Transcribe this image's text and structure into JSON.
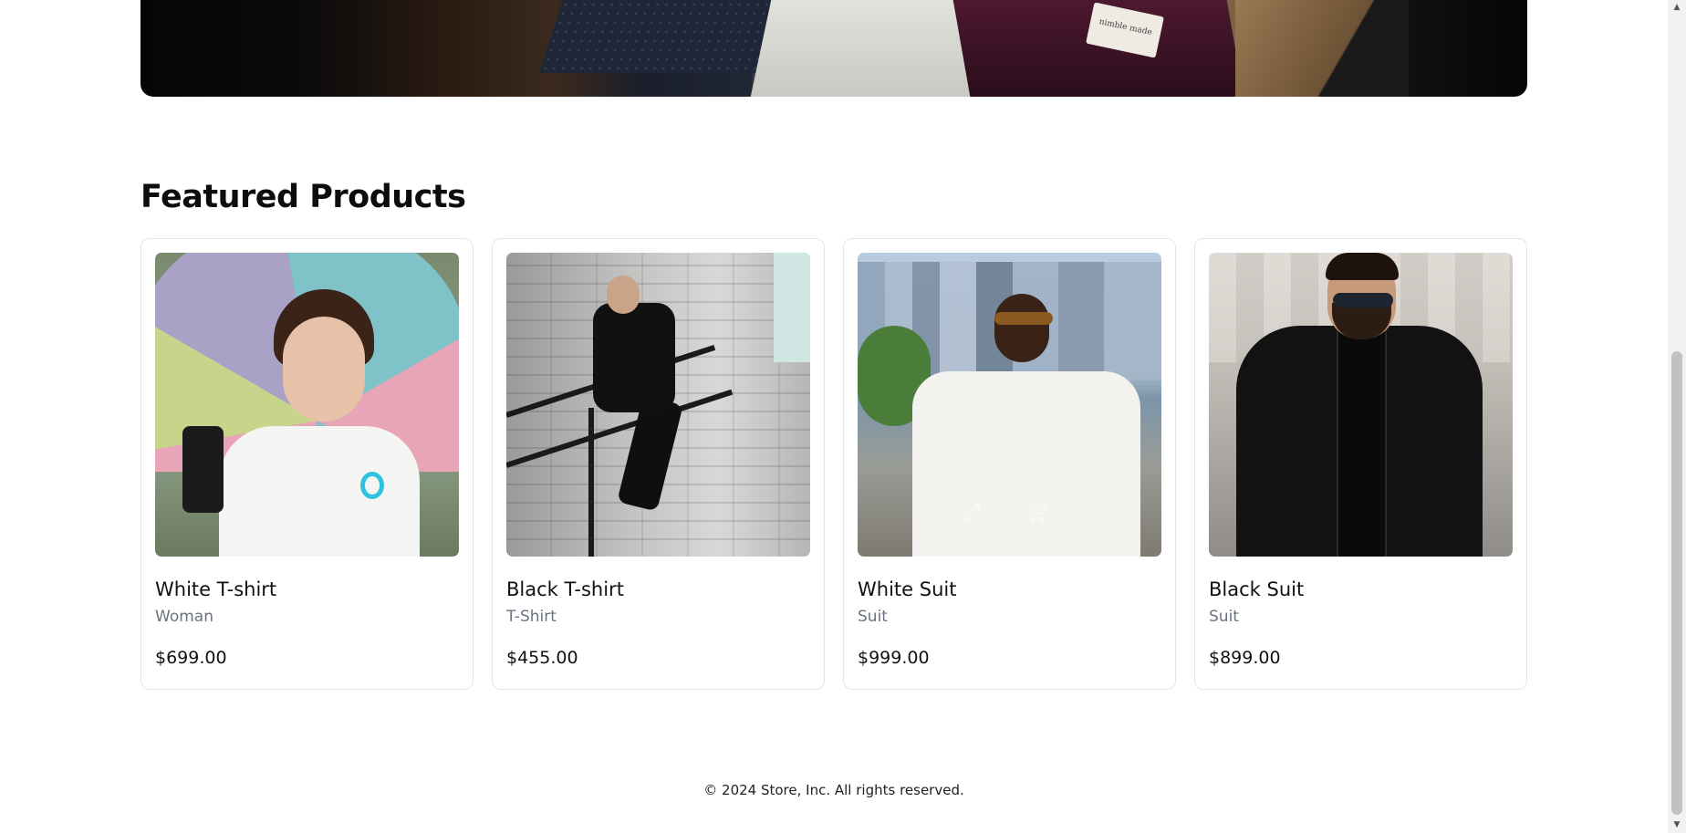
{
  "hero": {
    "label_text": "nimble made"
  },
  "featured": {
    "title": "Featured Products",
    "products": [
      {
        "name": "White T-shirt",
        "category": "Woman",
        "price": "$699.00",
        "image": "woman-umbrella-photo"
      },
      {
        "name": "Black T-shirt",
        "category": "T-Shirt",
        "price": "$455.00",
        "image": "man-jumping-railing-photo"
      },
      {
        "name": "White Suit",
        "category": "Suit",
        "price": "$999.00",
        "image": "man-white-suit-photo",
        "hover_icons": [
          "expand-icon",
          "cart-icon"
        ]
      },
      {
        "name": "Black Suit",
        "category": "Suit",
        "price": "$899.00",
        "image": "man-black-suit-photo"
      }
    ]
  },
  "footer": {
    "copyright": "© 2024 Store, Inc. All rights reserved."
  },
  "colors": {
    "text": "#111111",
    "muted": "#6b7280",
    "border": "#e6e6e6",
    "background": "#ffffff"
  }
}
